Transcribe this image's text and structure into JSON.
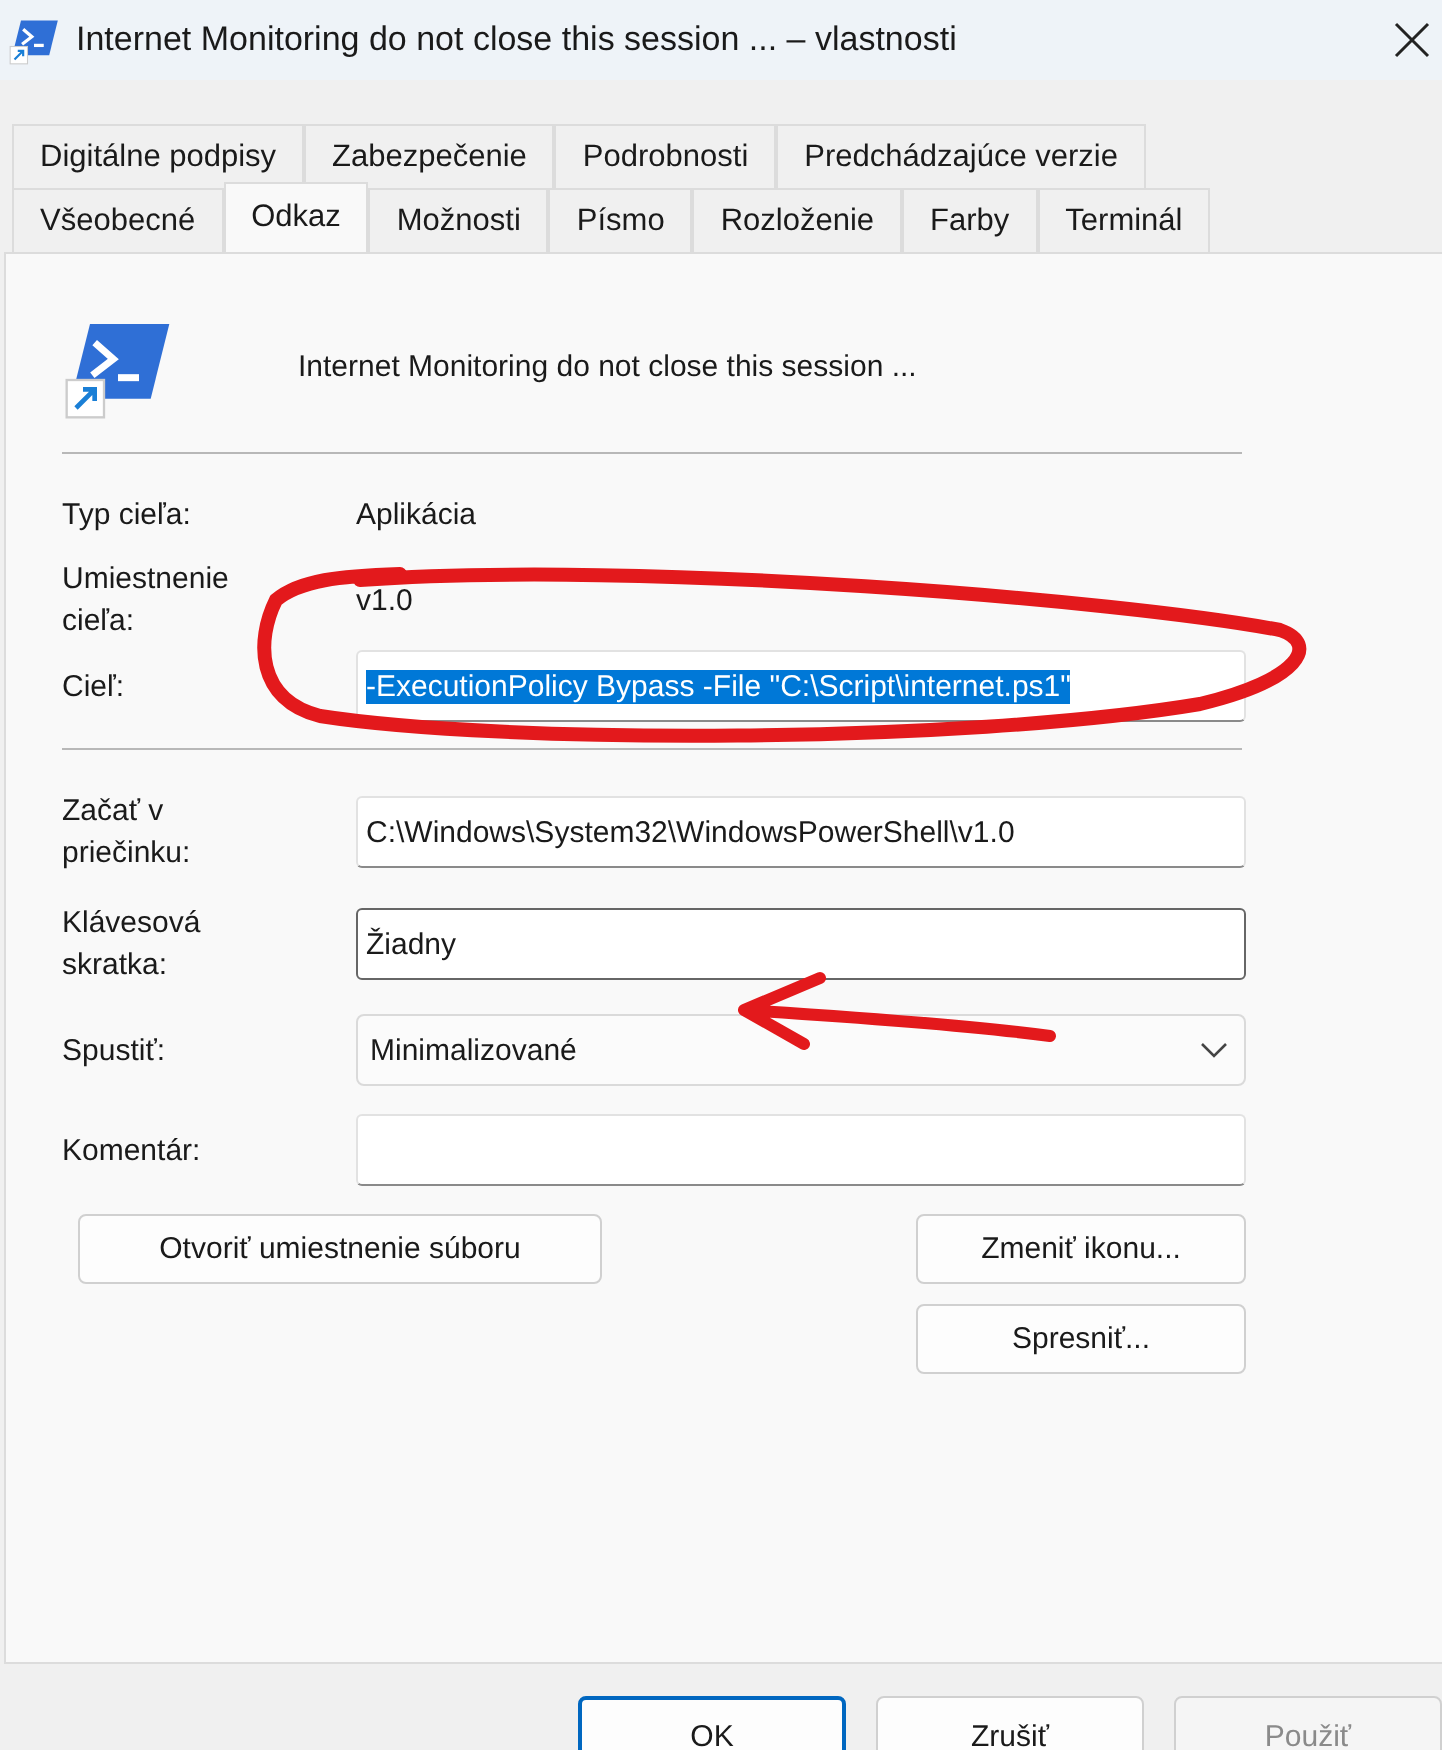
{
  "window": {
    "title": "Internet Monitoring do not close this session ... – vlastnosti"
  },
  "tab_rows": [
    {
      "tabs": [
        {
          "label": "Digitálne podpisy",
          "selected": false
        },
        {
          "label": "Zabezpečenie",
          "selected": false
        },
        {
          "label": "Podrobnosti",
          "selected": false
        },
        {
          "label": "Predchádzajúce verzie",
          "selected": false
        }
      ]
    },
    {
      "tabs": [
        {
          "label": "Všeobecné",
          "selected": false
        },
        {
          "label": "Odkaz",
          "selected": true
        },
        {
          "label": "Možnosti",
          "selected": false
        },
        {
          "label": "Písmo",
          "selected": false
        },
        {
          "label": "Rozloženie",
          "selected": false
        },
        {
          "label": "Farby",
          "selected": false
        },
        {
          "label": "Terminál",
          "selected": false
        }
      ]
    }
  ],
  "shortcut": {
    "name": "Internet Monitoring do not close this session ..."
  },
  "target_fields": [
    {
      "kind": "text",
      "label": "Typ cieľa:",
      "value": "Aplikácia"
    },
    {
      "kind": "text",
      "label": "Umiestnenie cieľa:",
      "value": "v1.0"
    },
    {
      "kind": "input",
      "label": "Cieľ:",
      "value": "-ExecutionPolicy Bypass -File \"C:\\Script\\internet.ps1\"",
      "selected": true,
      "focused": false
    }
  ],
  "start_fields": [
    {
      "kind": "input",
      "label": "Začať v priečinku:",
      "value": "C:\\Windows\\System32\\WindowsPowerShell\\v1.0",
      "selected": false,
      "focused": false
    },
    {
      "kind": "input",
      "label": "Klávesová skratka:",
      "value": "Žiadny",
      "selected": false,
      "focused": true
    },
    {
      "kind": "dropdown",
      "label": "Spustiť:",
      "value": "Minimalizované"
    },
    {
      "kind": "input",
      "label": "Komentár:",
      "focused": false
    }
  ],
  "action_buttons": [
    {
      "label": "Otvoriť umiestnenie súboru"
    },
    {
      "label": "Zmeniť ikonu..."
    },
    {
      "label": "Spresniť..."
    }
  ],
  "dialog_buttons": [
    {
      "label": "OK",
      "default": true,
      "disabled": false
    },
    {
      "label": "Zrušiť",
      "default": false,
      "disabled": false
    },
    {
      "label": "Použiť",
      "default": false,
      "disabled": true
    }
  ]
}
